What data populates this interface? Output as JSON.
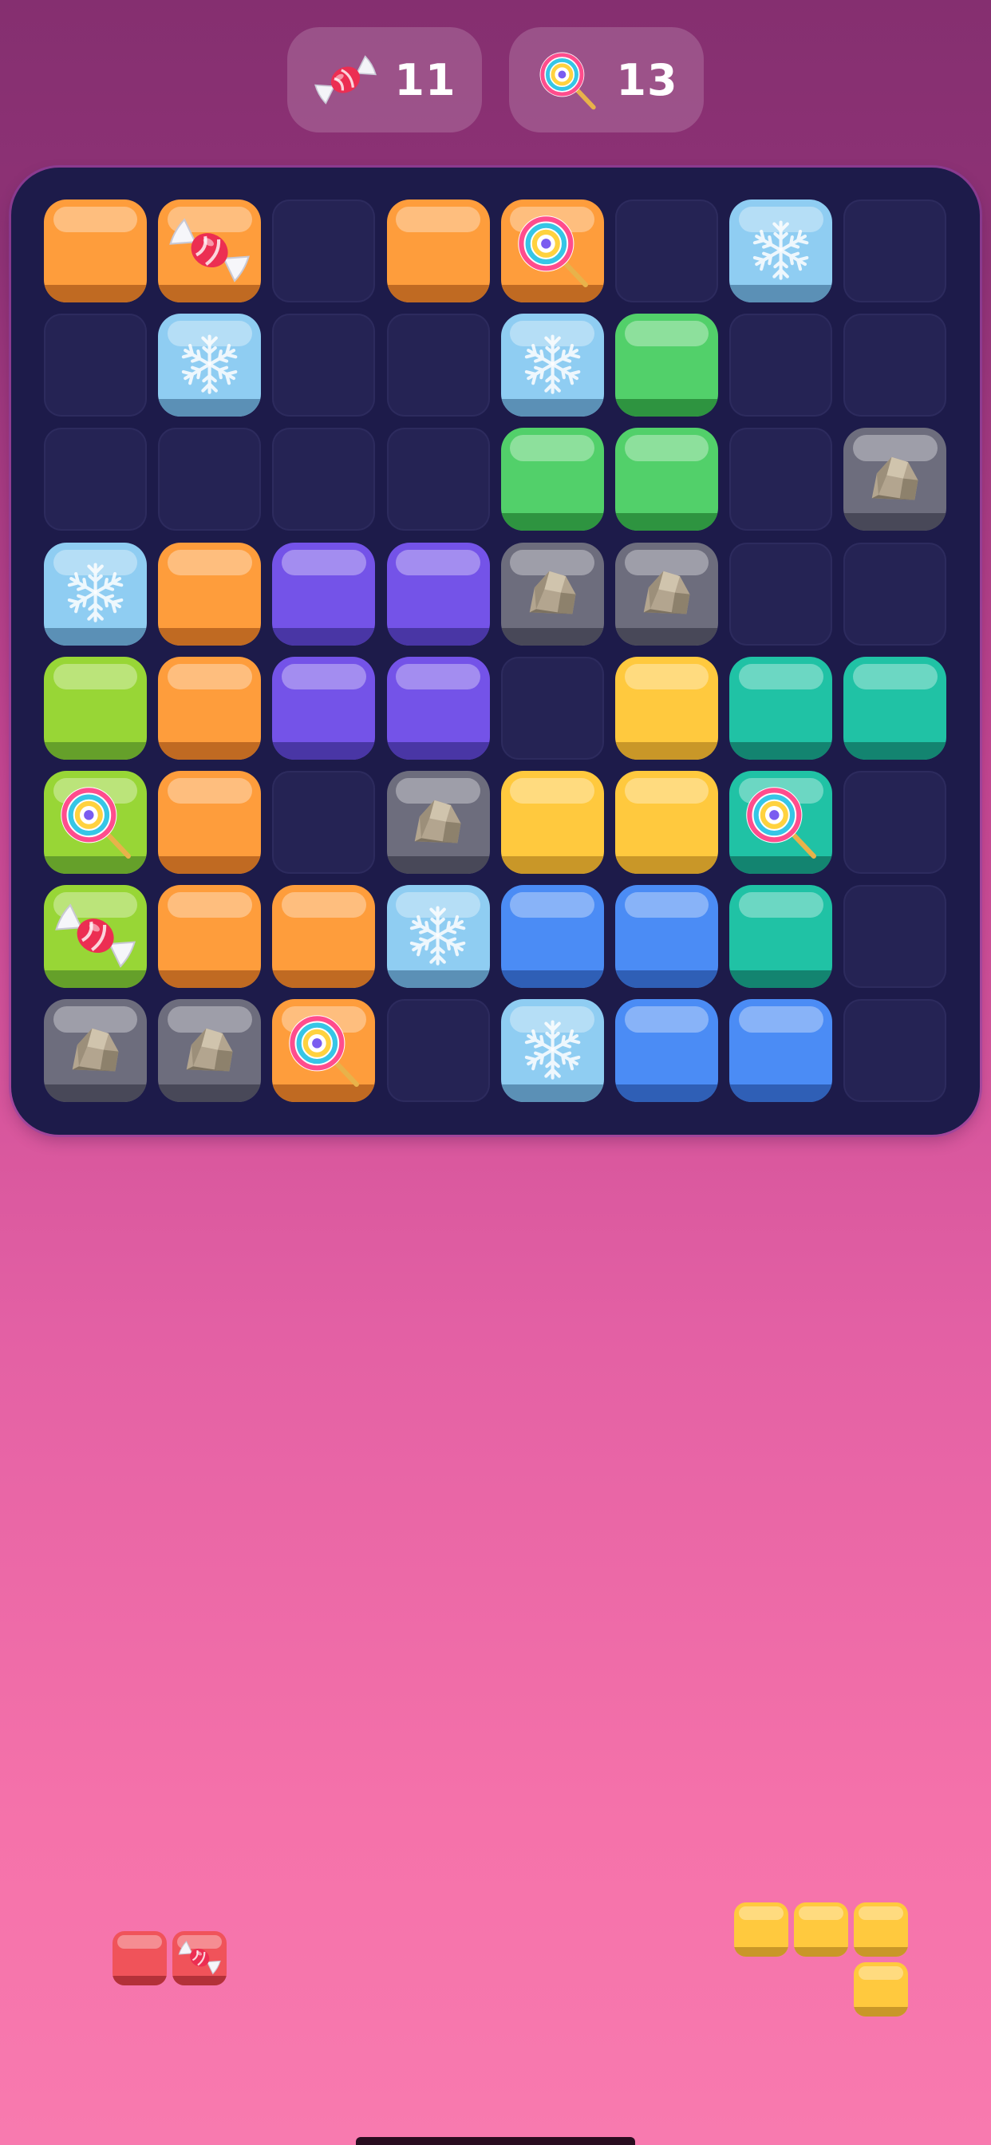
{
  "goals": [
    {
      "icon": "wrapped-candy-icon",
      "count": "11"
    },
    {
      "icon": "lollipop-icon",
      "count": "13"
    }
  ],
  "colors": {
    "orange": {
      "fill": "#fe9d3c",
      "dark": "#c06a22"
    },
    "ice": {
      "fill": "#8fcdf2",
      "dark": "#5b90b6"
    },
    "green": {
      "fill": "#52d06a",
      "dark": "#2e9440"
    },
    "lime": {
      "fill": "#98d636",
      "dark": "#65a02a"
    },
    "purple": {
      "fill": "#7453e8",
      "dark": "#4936a5"
    },
    "gray": {
      "fill": "#6d6d7d",
      "dark": "#484858"
    },
    "yellow": {
      "fill": "#ffc93e",
      "dark": "#c99728"
    },
    "teal": {
      "fill": "#20c2a5",
      "dark": "#138470"
    },
    "blue": {
      "fill": "#4b8cf5",
      "dark": "#2f5fb6"
    },
    "red": {
      "fill": "#f0535a",
      "dark": "#b33139"
    }
  },
  "board": {
    "columns": 8,
    "rows": [
      [
        {
          "c": "orange"
        },
        {
          "c": "orange",
          "item": "candy"
        },
        null,
        {
          "c": "orange"
        },
        {
          "c": "orange",
          "item": "lollipop"
        },
        null,
        {
          "c": "ice",
          "item": "snowflake"
        },
        null
      ],
      [
        null,
        {
          "c": "ice",
          "item": "snowflake"
        },
        null,
        null,
        {
          "c": "ice",
          "item": "snowflake"
        },
        {
          "c": "green"
        },
        null,
        null
      ],
      [
        null,
        null,
        null,
        null,
        {
          "c": "green"
        },
        {
          "c": "green"
        },
        null,
        {
          "c": "gray",
          "item": "rock"
        }
      ],
      [
        {
          "c": "ice",
          "item": "snowflake"
        },
        {
          "c": "orange"
        },
        {
          "c": "purple"
        },
        {
          "c": "purple"
        },
        {
          "c": "gray",
          "item": "rock"
        },
        {
          "c": "gray",
          "item": "rock"
        },
        null,
        null
      ],
      [
        {
          "c": "lime"
        },
        {
          "c": "orange"
        },
        {
          "c": "purple"
        },
        {
          "c": "purple"
        },
        null,
        {
          "c": "yellow"
        },
        {
          "c": "teal"
        },
        {
          "c": "teal"
        }
      ],
      [
        {
          "c": "lime",
          "item": "lollipop"
        },
        {
          "c": "orange"
        },
        null,
        {
          "c": "gray",
          "item": "rock"
        },
        {
          "c": "yellow"
        },
        {
          "c": "yellow"
        },
        {
          "c": "teal",
          "item": "lollipop"
        },
        null
      ],
      [
        {
          "c": "lime",
          "item": "candy"
        },
        {
          "c": "orange"
        },
        {
          "c": "orange"
        },
        {
          "c": "ice",
          "item": "snowflake"
        },
        {
          "c": "blue"
        },
        {
          "c": "blue"
        },
        {
          "c": "teal"
        },
        null
      ],
      [
        {
          "c": "gray",
          "item": "rock"
        },
        {
          "c": "gray",
          "item": "rock"
        },
        {
          "c": "orange",
          "item": "lollipop"
        },
        null,
        {
          "c": "ice",
          "item": "snowflake"
        },
        {
          "c": "blue"
        },
        {
          "c": "blue"
        },
        null
      ]
    ]
  },
  "tray": [
    {
      "name": "tray-piece-red-pair",
      "cells": [
        {
          "r": 0,
          "c": 0,
          "color": "red"
        },
        {
          "r": 0,
          "c": 1,
          "color": "red",
          "item": "candy"
        }
      ]
    },
    {
      "name": "tray-piece-yellow-l",
      "cells": [
        {
          "r": 0,
          "c": 0,
          "color": "yellow"
        },
        {
          "r": 0,
          "c": 1,
          "color": "yellow"
        },
        {
          "r": 0,
          "c": 2,
          "color": "yellow"
        },
        {
          "r": 1,
          "c": 2,
          "color": "yellow"
        }
      ]
    }
  ]
}
